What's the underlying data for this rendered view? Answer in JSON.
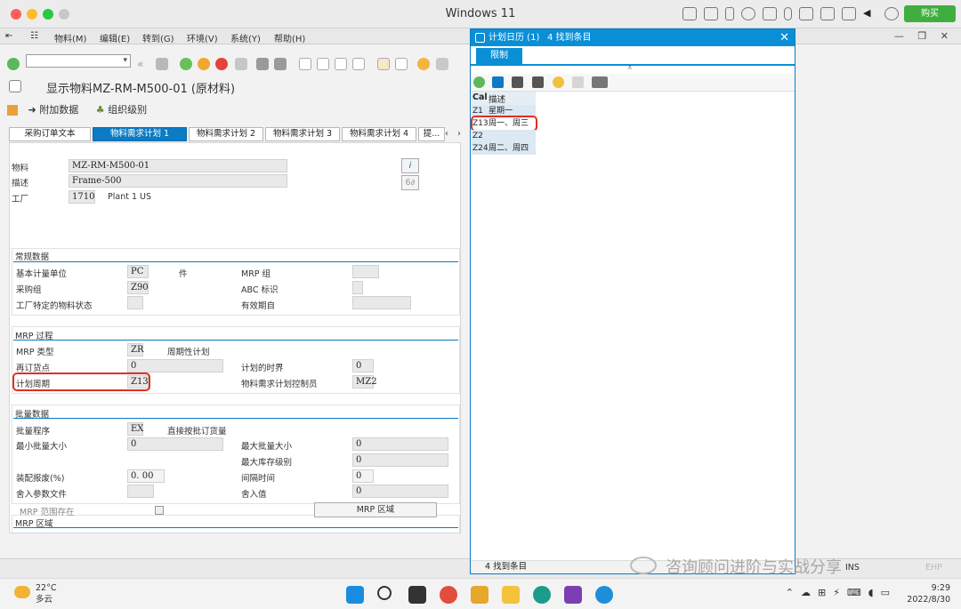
{
  "window": {
    "title": "Windows 11",
    "buy_button": "购买"
  },
  "menu": {
    "items": [
      "物料(M)",
      "编辑(E)",
      "转到(G)",
      "环境(V)",
      "系统(Y)",
      "帮助(H)"
    ],
    "window_controls": "— ❐ ✕"
  },
  "page": {
    "title": "显示物料MZ-RM-M500-01 (原材料)"
  },
  "app_toolbar": {
    "additional_data": "附加数据",
    "org_levels": "组织级别"
  },
  "tabs": [
    "采购订单文本",
    "物料需求计划 1",
    "物料需求计划 2",
    "物料需求计划 3",
    "物料需求计划 4",
    "提..."
  ],
  "header": {
    "material_label": "物料",
    "material_value": "MZ-RM-M500-01",
    "desc_label": "描述",
    "desc_value": "Frame-500",
    "plant_label": "工厂",
    "plant_value": "1710",
    "plant_name": "Plant 1 US",
    "info_icon": "i",
    "glasses_icon": "6∂"
  },
  "general": {
    "title": "常规数据",
    "base_uom_label": "基本计量单位",
    "base_uom_value": "PC",
    "base_uom_text": "件",
    "mrp_group_label": "MRP 组",
    "purch_group_label": "采购组",
    "purch_group_value": "Z90",
    "abc_label": "ABC 标识",
    "plant_status_label": "工厂特定的物料状态",
    "valid_from_label": "有效期自"
  },
  "mrp_proc": {
    "title": "MRP 过程",
    "mrp_type_label": "MRP 类型",
    "mrp_type_value": "ZR",
    "mrp_type_text": "周期性计划",
    "reorder_label": "再订货点",
    "reorder_value": "0",
    "plan_horizon_label": "计划的时界",
    "plan_horizon_value": "0",
    "plan_cycle_label": "计划周期",
    "plan_cycle_value": "Z13",
    "controller_label": "物料需求计划控制员",
    "controller_value": "MZ2"
  },
  "lot": {
    "title": "批量数据",
    "procedure_label": "批量程序",
    "procedure_value": "EX",
    "procedure_text": "直接按批订货量",
    "min_label": "最小批量大小",
    "min_value": "0",
    "max_label": "最大批量大小",
    "max_value": "0",
    "max_stock_label": "最大库存级别",
    "max_stock_value": "0",
    "scrap_label": "装配报废(%)",
    "scrap_value": "0. 00",
    "interval_label": "间隔时间",
    "interval_value": "0",
    "rounding_profile_label": "舍入参数文件",
    "rounding_value_label": "舍入值",
    "rounding_value": "0"
  },
  "mrp_area": {
    "title": "MRP 区域",
    "exists_label": "MRP 范围存在",
    "button": "MRP 区域"
  },
  "popup": {
    "title": "计划日历 (1)",
    "found_count": "4 找到条目",
    "tab": "限制",
    "col_cal": "Cal",
    "col_desc": "描述",
    "rows": [
      {
        "cal": "Z1",
        "desc": "星期一"
      },
      {
        "cal": "Z13",
        "desc": "周一、周三"
      },
      {
        "cal": "Z2",
        "desc": ""
      },
      {
        "cal": "Z24",
        "desc": "周二、周四"
      }
    ],
    "status": "4 找到条目"
  },
  "sap_status": {
    "mode": "INS",
    "server": "EHP"
  },
  "taskbar": {
    "temperature": "22°C",
    "weather": "多云",
    "time": "9:29",
    "date": "2022/8/30"
  },
  "watermark": "咨询顾问进阶与实战分享",
  "colors": {
    "sap_blue": "#0a8fd6",
    "highlight_red": "#e0301e",
    "buy_green": "#3fae3f"
  }
}
